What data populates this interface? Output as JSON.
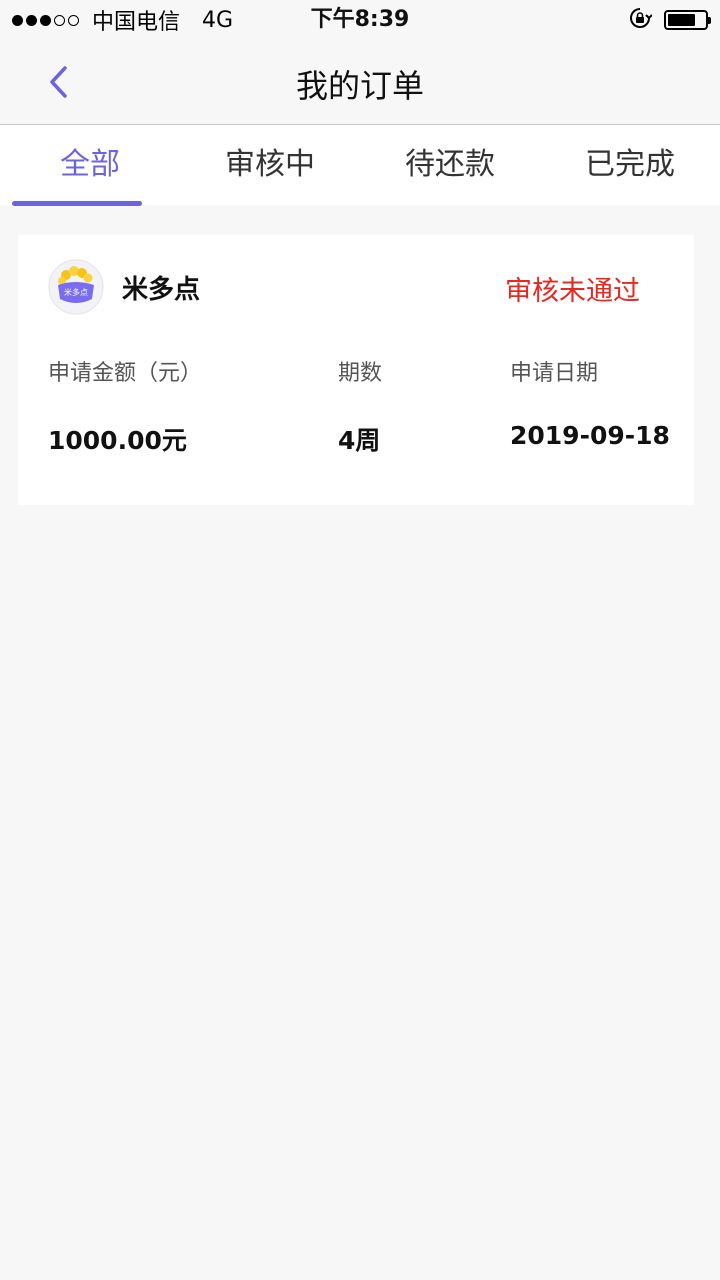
{
  "status_bar": {
    "signal_filled": 3,
    "signal_empty": 2,
    "carrier": "中国电信",
    "network": "4G",
    "time": "下午8:39",
    "battery_level": 0.75
  },
  "nav": {
    "title": "我的订单",
    "back_icon": "chevron-left-icon",
    "accent_color": "#6b63e0"
  },
  "tabs": [
    {
      "label": "全部",
      "active": true
    },
    {
      "label": "审核中",
      "active": false
    },
    {
      "label": "待还款",
      "active": false
    },
    {
      "label": "已完成",
      "active": false
    }
  ],
  "order": {
    "product_name": "米多点",
    "logo_text": "米多点",
    "status": "审核未通过",
    "status_color": "#e8281e",
    "labels": {
      "amount": "申请金额（元）",
      "periods": "期数",
      "date": "申请日期"
    },
    "values": {
      "amount": "1000.00元",
      "periods": "4周",
      "date": "2019-09-18"
    }
  }
}
